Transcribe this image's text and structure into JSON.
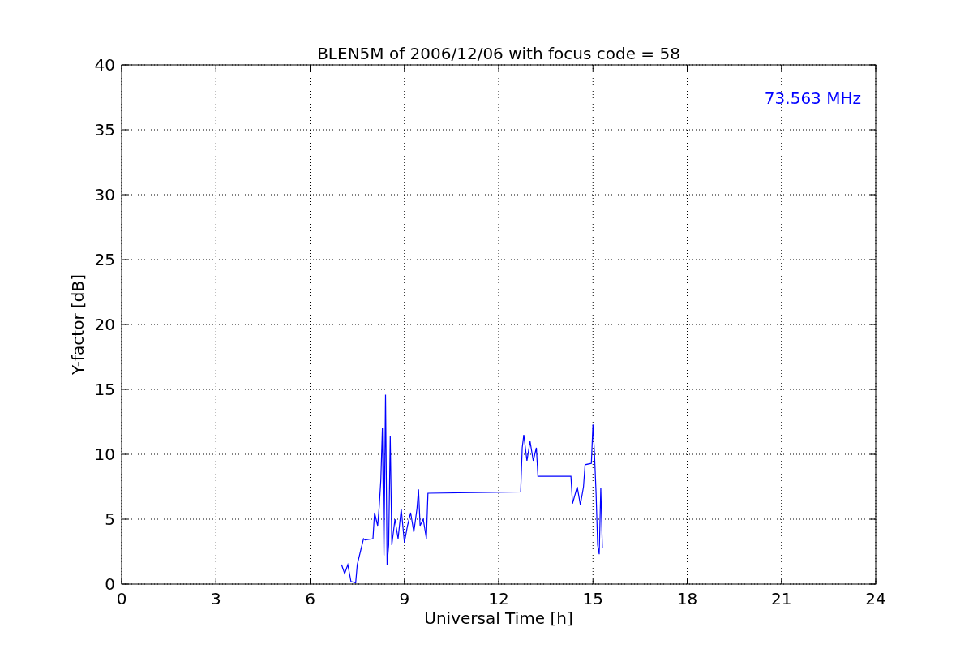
{
  "chart_data": {
    "type": "line",
    "title": "BLEN5M of 2006/12/06 with focus code = 58",
    "xlabel": "Universal Time [h]",
    "ylabel": "Y-factor [dB]",
    "x": [
      7.0,
      7.1,
      7.2,
      7.3,
      7.45,
      7.5,
      7.6,
      7.7,
      7.75,
      8.0,
      8.05,
      8.15,
      8.2,
      8.25,
      8.3,
      8.35,
      8.4,
      8.45,
      8.5,
      8.55,
      8.6,
      8.7,
      8.8,
      8.9,
      9.0,
      9.1,
      9.2,
      9.3,
      9.4,
      9.45,
      9.5,
      9.6,
      9.7,
      9.75,
      12.7,
      12.75,
      12.8,
      12.9,
      13.0,
      13.1,
      13.2,
      13.25,
      14.3,
      14.35,
      14.5,
      14.6,
      14.7,
      14.75,
      14.95,
      15.0,
      15.05,
      15.1,
      15.15,
      15.2,
      15.25,
      15.3
    ],
    "series": [
      {
        "name": "73.563 MHz",
        "color": "#0000ff",
        "values": [
          1.5,
          0.8,
          1.5,
          0.2,
          0.1,
          1.5,
          2.5,
          3.5,
          3.4,
          3.5,
          5.5,
          4.5,
          6,
          8,
          12,
          2.2,
          14.6,
          1.5,
          3,
          11.4,
          3,
          5,
          3.5,
          5.8,
          3.2,
          4.5,
          5.5,
          4.0,
          5.8,
          7.3,
          4.5,
          5,
          3.5,
          7,
          7.1,
          10.5,
          11.5,
          9.5,
          11,
          9.5,
          10.5,
          8.3,
          8.3,
          6.2,
          7.5,
          6.1,
          7.5,
          9.2,
          9.3,
          12.3,
          10,
          7,
          3,
          2.3,
          7.4,
          2.8
        ]
      }
    ],
    "xlim": [
      0,
      24
    ],
    "ylim": [
      0,
      40
    ],
    "xticks": [
      0,
      3,
      6,
      9,
      12,
      15,
      18,
      21,
      24
    ],
    "yticks": [
      0,
      5,
      10,
      15,
      20,
      25,
      30,
      35,
      40
    ],
    "grid": true
  }
}
